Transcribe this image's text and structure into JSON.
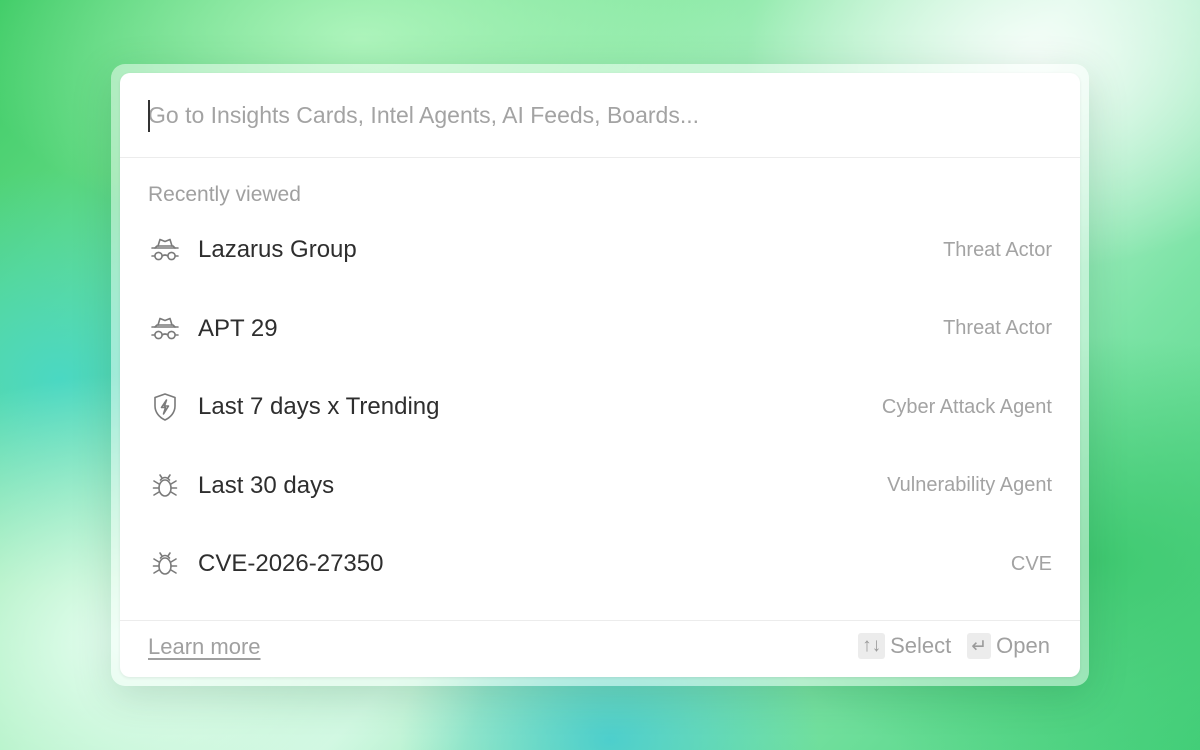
{
  "search": {
    "placeholder": "Go to Insights Cards, Intel Agents, AI Feeds, Boards..."
  },
  "recent": {
    "label": "Recently viewed",
    "items": [
      {
        "title": "Lazarus Group",
        "kind": "Threat Actor",
        "icon": "spy-icon"
      },
      {
        "title": "APT 29",
        "kind": "Threat Actor",
        "icon": "spy-icon"
      },
      {
        "title": "Last 7 days x Trending",
        "kind": "Cyber Attack Agent",
        "icon": "shield-bolt-icon"
      },
      {
        "title": "Last 30 days",
        "kind": "Vulnerability Agent",
        "icon": "bug-icon"
      },
      {
        "title": "CVE-2026-27350",
        "kind": "CVE",
        "icon": "bug-icon"
      }
    ]
  },
  "footer": {
    "learn_more": "Learn more",
    "select_keys": "↑↓",
    "select_label": "Select",
    "open_key": "↵",
    "open_label": "Open"
  },
  "colors": {
    "text_primary": "#2e2e2e",
    "text_muted": "#a3a3a3",
    "surface": "#ffffff"
  }
}
